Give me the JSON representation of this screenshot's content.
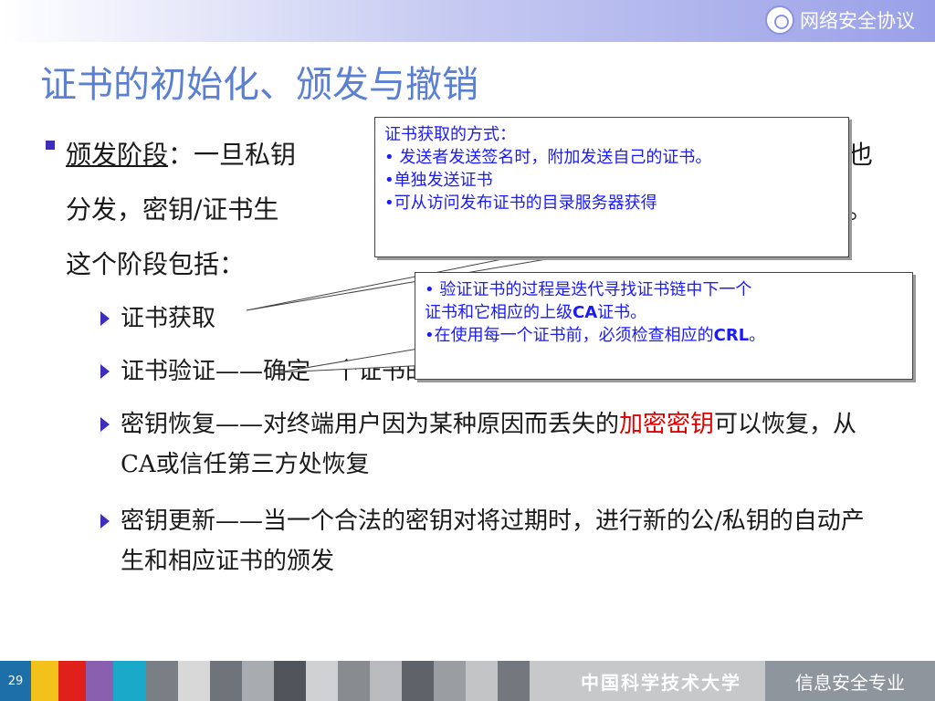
{
  "header": {
    "brand": "网络安全协议"
  },
  "slide": {
    "title": "证书的初始化、颁发与撤销",
    "bullet": {
      "term": "颁发阶段",
      "sep": "：",
      "line1_visible": "一旦私钥",
      "line1_end": "也",
      "line2_start": "分发，密钥/证书生",
      "line2_end": "。",
      "line3": "这个阶段包括："
    },
    "subitems": [
      {
        "text": "证书获取"
      },
      {
        "text": "证书验证——确定一个证书的有效性"
      },
      {
        "pre": "密钥恢复——对终端用户因为某种原因而丢失的",
        "red": "加密密钥",
        "post": "可以恢复，从CA或信任第三方处恢复"
      },
      {
        "text": "密钥更新——当一个合法的密钥对将过期时，进行新的公/私钥的自动产生和相应证书的颁发"
      }
    ],
    "callout1": {
      "lines": [
        "证书获取的方式：",
        "• 发送者发送签名时，附加发送自己的证书。",
        "•单独发送证书",
        "•可从访问发布证书的目录服务器获得"
      ]
    },
    "callout2": {
      "line1": "• 验证证书的过程是迭代寻找证书链中下一个",
      "line2a": "证书和它相应的上级",
      "line2b": "CA",
      "line2c": "证书。",
      "line3a": "•在使用每一个证书前，必须检查相应的",
      "line3b": "CRL",
      "line3c": "。"
    }
  },
  "footer": {
    "page": "29",
    "university": "中国科学技术大学",
    "department": "信息安全专业"
  },
  "colors": {
    "title": "#5b7fd1",
    "callout_text": "#1a1aff",
    "highlight": "#e00000",
    "bullet": "#3c2dbd"
  }
}
